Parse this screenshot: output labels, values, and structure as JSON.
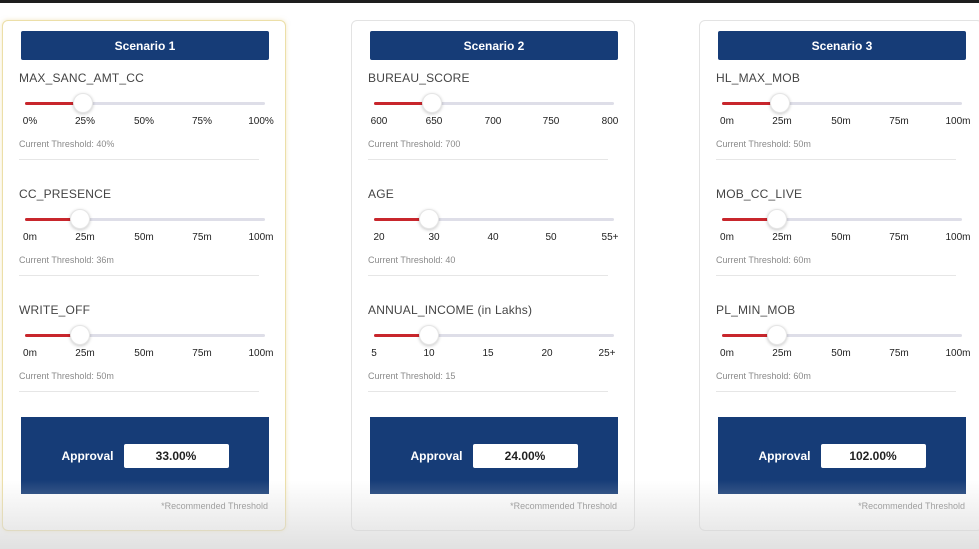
{
  "colors": {
    "header": "#163c77",
    "track_fill": "#c8262c",
    "track": "#dedee8"
  },
  "scenarios": [
    {
      "title": "Scenario 1",
      "params": [
        {
          "name": "MAX_SANC_AMT_CC",
          "ticks": [
            "0%",
            "25%",
            "50%",
            "75%",
            "100%"
          ],
          "threshold": "Current Threshold: 40%",
          "level": 0.24
        },
        {
          "name": "CC_PRESENCE",
          "ticks": [
            "0m",
            "25m",
            "50m",
            "75m",
            "100m"
          ],
          "threshold": "Current Threshold: 36m",
          "level": 0.23
        },
        {
          "name": "WRITE_OFF",
          "ticks": [
            "0m",
            "25m",
            "50m",
            "75m",
            "100m"
          ],
          "threshold": "Current Threshold: 50m",
          "level": 0.23
        }
      ],
      "approval_label": "Approval",
      "approval_value": "33.00%",
      "note": "*Recommended Threshold"
    },
    {
      "title": "Scenario 2",
      "params": [
        {
          "name": "BUREAU_SCORE",
          "ticks": [
            "600",
            "650",
            "700",
            "750",
            "800"
          ],
          "threshold": "Current Threshold: 700",
          "level": 0.24
        },
        {
          "name": "AGE",
          "ticks": [
            "20",
            "30",
            "40",
            "50",
            "55+"
          ],
          "threshold": "Current Threshold: 40",
          "level": 0.23
        },
        {
          "name": "ANNUAL_INCOME (in Lakhs)",
          "ticks": [
            "5",
            "10",
            "15",
            "20",
            "25+"
          ],
          "threshold": "Current Threshold: 15",
          "level": 0.23
        }
      ],
      "approval_label": "Approval",
      "approval_value": "24.00%",
      "note": "*Recommended Threshold"
    },
    {
      "title": "Scenario 3",
      "params": [
        {
          "name": "HL_MAX_MOB",
          "ticks": [
            "0m",
            "25m",
            "50m",
            "75m",
            "100m"
          ],
          "threshold": "Current Threshold: 50m",
          "level": 0.24
        },
        {
          "name": "MOB_CC_LIVE",
          "ticks": [
            "0m",
            "25m",
            "50m",
            "75m",
            "100m"
          ],
          "threshold": "Current Threshold: 60m",
          "level": 0.23
        },
        {
          "name": "PL_MIN_MOB",
          "ticks": [
            "0m",
            "25m",
            "50m",
            "75m",
            "100m"
          ],
          "threshold": "Current Threshold: 60m",
          "level": 0.23
        }
      ],
      "approval_label": "Approval",
      "approval_value": "102.00%",
      "note": "*Recommended Threshold"
    }
  ]
}
